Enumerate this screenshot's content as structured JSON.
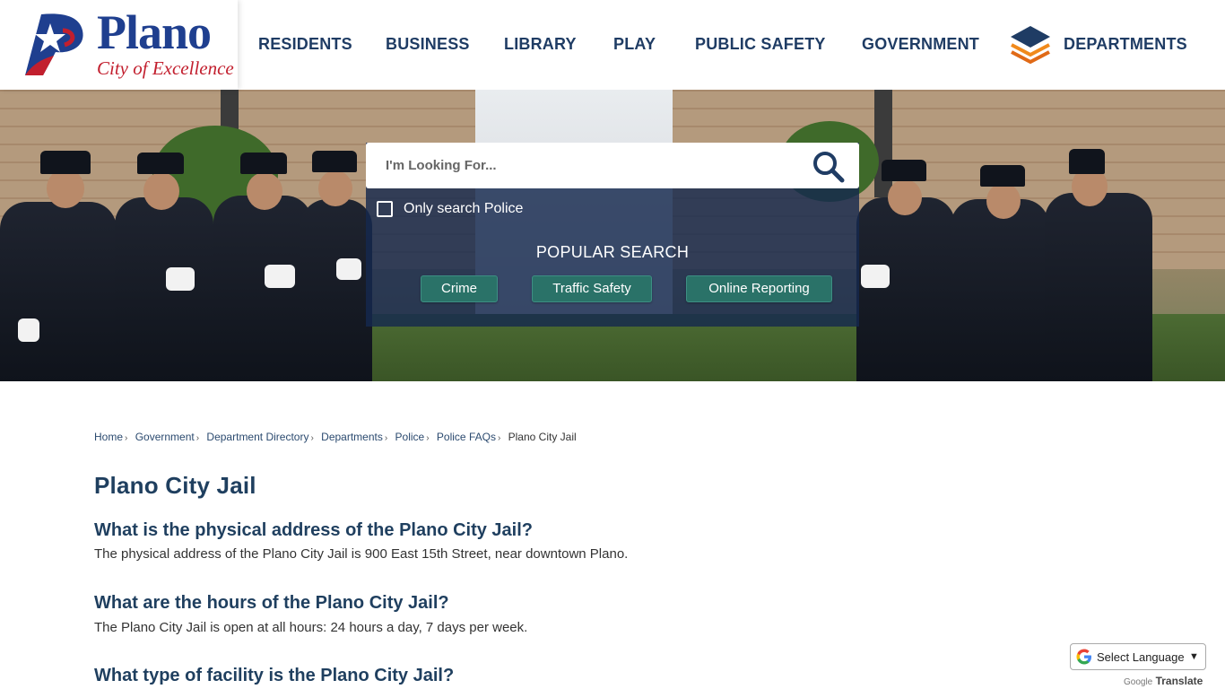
{
  "header": {
    "logo": {
      "name": "Plano",
      "tagline": "City of Excellence"
    },
    "nav": [
      {
        "label": "RESIDENTS"
      },
      {
        "label": "BUSINESS"
      },
      {
        "label": "LIBRARY"
      },
      {
        "label": "PLAY"
      },
      {
        "label": "PUBLIC SAFETY"
      },
      {
        "label": "GOVERNMENT"
      },
      {
        "label": "DEPARTMENTS",
        "icon": "layered-stack-icon"
      }
    ]
  },
  "search": {
    "placeholder": "I'm Looking For...",
    "value": "",
    "button_icon": "search-icon",
    "only_search_label": "Only search Police",
    "only_search_checked": false,
    "popular_title": "POPULAR SEARCH",
    "popular": [
      "Crime",
      "Traffic Safety",
      "Online Reporting"
    ]
  },
  "breadcrumb": [
    "Home",
    "Government",
    "Department Directory",
    "Departments",
    "Police",
    "Police FAQs",
    "Plano City Jail"
  ],
  "page": {
    "title": "Plano City Jail",
    "faqs": [
      {
        "q": "What is the physical address of the Plano City Jail?",
        "a": "The physical address of the Plano City Jail is 900 East 15th Street, near downtown Plano."
      },
      {
        "q": "What are the hours of the Plano City Jail?",
        "a": "The Plano City Jail is open at all hours: 24 hours a day, 7 days per week."
      },
      {
        "q": "What type of facility is the Plano City Jail?",
        "a": ""
      }
    ]
  },
  "translate": {
    "select_label": "Select Language",
    "powered_google": "Google",
    "powered_translate": "Translate"
  },
  "colors": {
    "brand_blue": "#1f3f8f",
    "brand_red": "#c21f2e",
    "nav_text": "#1f3c64",
    "search_panel": "#15284e",
    "pill_teal": "#2a7268",
    "heading": "#1f3f5f"
  }
}
